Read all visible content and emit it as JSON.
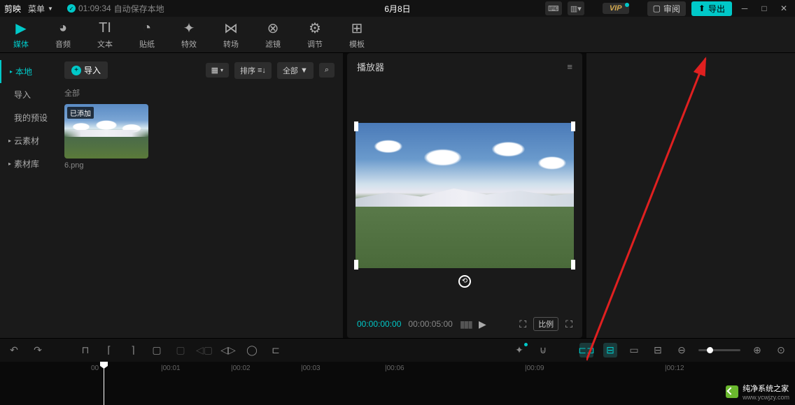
{
  "topbar": {
    "app_name": "剪映",
    "menu_label": "菜单",
    "autosave_time": "01:09:34",
    "autosave_text": "自动保存本地",
    "project_title": "6月8日",
    "vip_label": "VIP",
    "review_label": "审阅",
    "export_label": "导出"
  },
  "tool_tabs": [
    {
      "icon": "▶",
      "label": "媒体",
      "active": true
    },
    {
      "icon": "◕",
      "label": "音频"
    },
    {
      "icon": "TI",
      "label": "文本"
    },
    {
      "icon": "◔",
      "label": "贴纸"
    },
    {
      "icon": "✦",
      "label": "特效"
    },
    {
      "icon": "⋈",
      "label": "转场"
    },
    {
      "icon": "⊗",
      "label": "滤镜"
    },
    {
      "icon": "⚙",
      "label": "调节"
    },
    {
      "icon": "⊞",
      "label": "模板"
    }
  ],
  "sidebar": {
    "items": [
      {
        "label": "本地",
        "active": true,
        "expandable": true
      },
      {
        "label": "导入",
        "sub": true
      },
      {
        "label": "我的预设",
        "sub": true
      },
      {
        "label": "云素材",
        "expandable": true
      },
      {
        "label": "素材库",
        "expandable": true
      }
    ]
  },
  "media": {
    "import_label": "导入",
    "sort_label": "排序",
    "filter_label": "全部",
    "section_label": "全部",
    "thumb": {
      "badge": "已添加",
      "name": "6.png"
    }
  },
  "player": {
    "title": "播放器",
    "time_current": "00:00:00:00",
    "time_total": "00:00:05:00",
    "ratio_label": "比例"
  },
  "timeline": {
    "marks": [
      "00",
      "|00:01",
      "|00:02",
      "|00:03",
      "|00:06",
      "|00:09",
      "|00:12"
    ]
  },
  "watermark": {
    "brand": "纯净系统之家",
    "url": "www.ycwjzy.com"
  }
}
